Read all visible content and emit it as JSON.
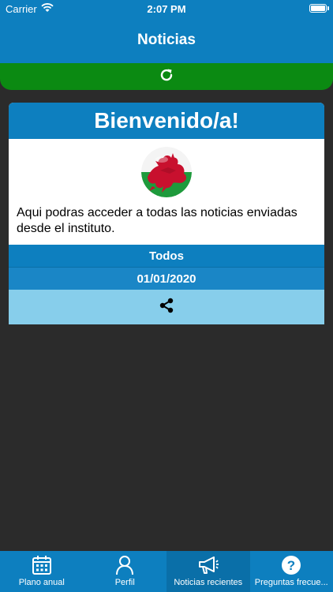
{
  "status_bar": {
    "carrier": "Carrier",
    "time": "2:07 PM"
  },
  "header": {
    "title": "Noticias"
  },
  "refresh": {
    "icon": "refresh-icon"
  },
  "card": {
    "title": "Bienvenido/a!",
    "image": "wales-flag",
    "text": "Aqui podras acceder a todas las noticias enviadas desde el instituto.",
    "category": "Todos",
    "date": "01/01/2020",
    "share_icon": "share-icon"
  },
  "tabs": [
    {
      "label": "Plano anual",
      "icon": "calendar-icon"
    },
    {
      "label": "Perfil",
      "icon": "person-icon"
    },
    {
      "label": "Noticias recientes",
      "icon": "megaphone-icon",
      "active": true
    },
    {
      "label": "Preguntas frecue...",
      "icon": "question-icon"
    }
  ],
  "colors": {
    "primary": "#0d7fbf",
    "success": "#0b8a12",
    "accent_light": "#87ceeb",
    "background": "#2b2b2b"
  }
}
